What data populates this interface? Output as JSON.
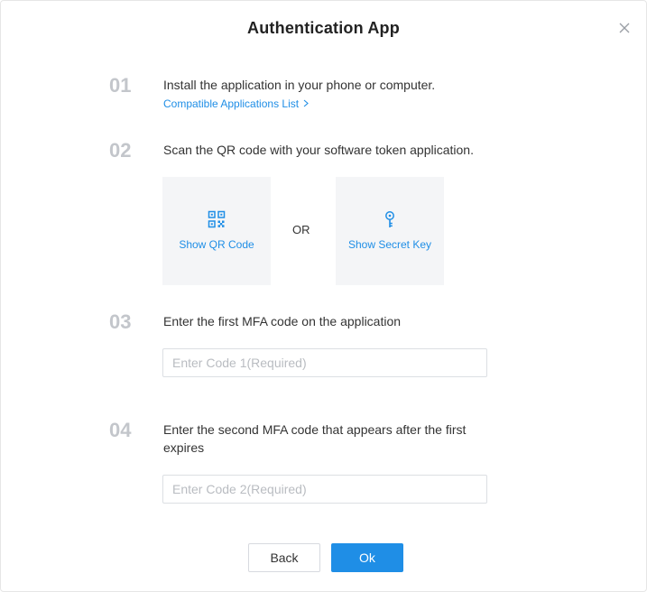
{
  "dialog": {
    "title": "Authentication App",
    "close_icon": "close-icon"
  },
  "steps": [
    {
      "number": "01",
      "text": "Install the application in your phone or computer.",
      "link": "Compatible Applications List",
      "link_icon": "chevron-right-icon"
    },
    {
      "number": "02",
      "text": "Scan the QR code with your software token application.",
      "qr_option": {
        "label": "Show QR Code",
        "icon": "qr-code-icon"
      },
      "or_text": "OR",
      "key_option": {
        "label": "Show Secret Key",
        "icon": "key-icon"
      }
    },
    {
      "number": "03",
      "text": "Enter the first MFA code on the application",
      "input_value": "",
      "input_placeholder": "Enter Code 1(Required)"
    },
    {
      "number": "04",
      "text": "Enter the second MFA code that appears after the first expires",
      "input_value": "",
      "input_placeholder": "Enter Code 2(Required)"
    }
  ],
  "footer": {
    "back_label": "Back",
    "ok_label": "Ok"
  },
  "colors": {
    "accent": "#1f8ee6",
    "step_number": "#c3c6cb",
    "tile_bg": "#f4f5f7"
  }
}
